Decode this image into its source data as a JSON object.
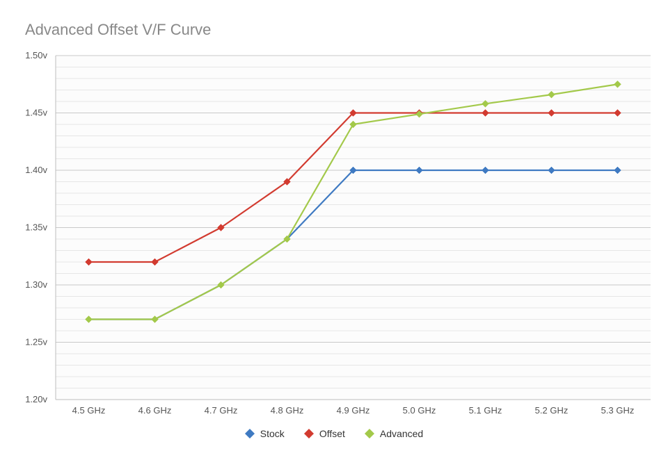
{
  "chart_data": {
    "type": "line",
    "title": "Advanced Offset V/F Curve",
    "xlabel": "",
    "ylabel": "",
    "ylim": [
      1.2,
      1.5
    ],
    "yticks": [
      1.2,
      1.25,
      1.3,
      1.35,
      1.4,
      1.45,
      1.5
    ],
    "ytick_labels": [
      "1.20v",
      "1.25v",
      "1.30v",
      "1.35v",
      "1.40v",
      "1.45v",
      "1.50v"
    ],
    "categories": [
      "4.5 GHz",
      "4.6 GHz",
      "4.7 GHz",
      "4.8 GHz",
      "4.9 GHz",
      "5.0 GHz",
      "5.1 GHz",
      "5.2 GHz",
      "5.3 GHz"
    ],
    "series": [
      {
        "name": "Stock",
        "color": "#3f7ac2",
        "values": [
          1.27,
          1.27,
          1.3,
          1.34,
          1.4,
          1.4,
          1.4,
          1.4,
          1.4
        ]
      },
      {
        "name": "Offset",
        "color": "#d23b30",
        "values": [
          1.32,
          1.32,
          1.35,
          1.39,
          1.45,
          1.45,
          1.45,
          1.45,
          1.45
        ]
      },
      {
        "name": "Advanced",
        "color": "#a3c94a",
        "values": [
          1.27,
          1.27,
          1.3,
          1.34,
          1.44,
          1.449,
          1.458,
          1.466,
          1.475
        ]
      }
    ],
    "legend_position": "bottom"
  }
}
